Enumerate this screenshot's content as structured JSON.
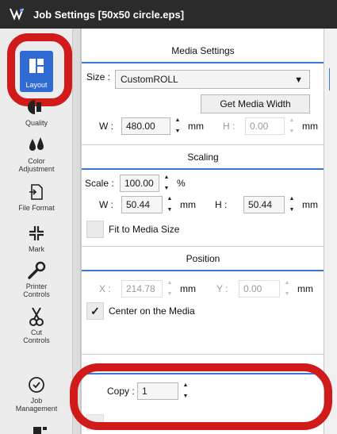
{
  "window": {
    "title": "Job Settings [50x50 circle.eps]"
  },
  "sidebar": {
    "items": [
      {
        "label": "Layout",
        "icon": "layout-icon",
        "selected": true
      },
      {
        "label": "Quality",
        "icon": "quality-icon"
      },
      {
        "label": "Color\nAdjustment",
        "icon": "color-adjustment-icon"
      },
      {
        "label": "File Format",
        "icon": "file-format-icon"
      },
      {
        "label": "Mark",
        "icon": "mark-icon"
      },
      {
        "label": "Printer\nControls",
        "icon": "printer-controls-icon"
      },
      {
        "label": "Cut\nControls",
        "icon": "cut-controls-icon"
      },
      {
        "label": "Job\nManagement",
        "icon": "job-management-icon"
      }
    ]
  },
  "media_settings": {
    "title": "Media Settings",
    "size_label": "Size :",
    "size_value": "CustomROLL",
    "get_width_button": "Get Media Width",
    "w_label": "W :",
    "w_value": "480.00",
    "w_unit": "mm",
    "h_label": "H :",
    "h_value": "0.00",
    "h_unit": "mm"
  },
  "scaling": {
    "title": "Scaling",
    "scale_label": "Scale :",
    "scale_value": "100.00",
    "scale_unit": "%",
    "w_label": "W :",
    "w_value": "50.44",
    "w_unit": "mm",
    "h_label": "H :",
    "h_value": "50.44",
    "h_unit": "mm",
    "fit_label": "Fit to Media Size",
    "fit_checked": false
  },
  "position": {
    "title": "Position",
    "x_label": "X :",
    "x_value": "214.78",
    "x_unit": "mm",
    "y_label": "Y :",
    "y_value": "0.00",
    "y_unit": "mm",
    "center_label": "Center on the Media",
    "center_checked": true,
    "center_check_glyph": "✓"
  },
  "print_properties": {
    "copy_label": "Copy :",
    "copy_value": "1"
  },
  "colors": {
    "accent": "#3a7bd5",
    "selected_bg": "#2f6bd3",
    "highlight_ring": "#d11a1a"
  }
}
